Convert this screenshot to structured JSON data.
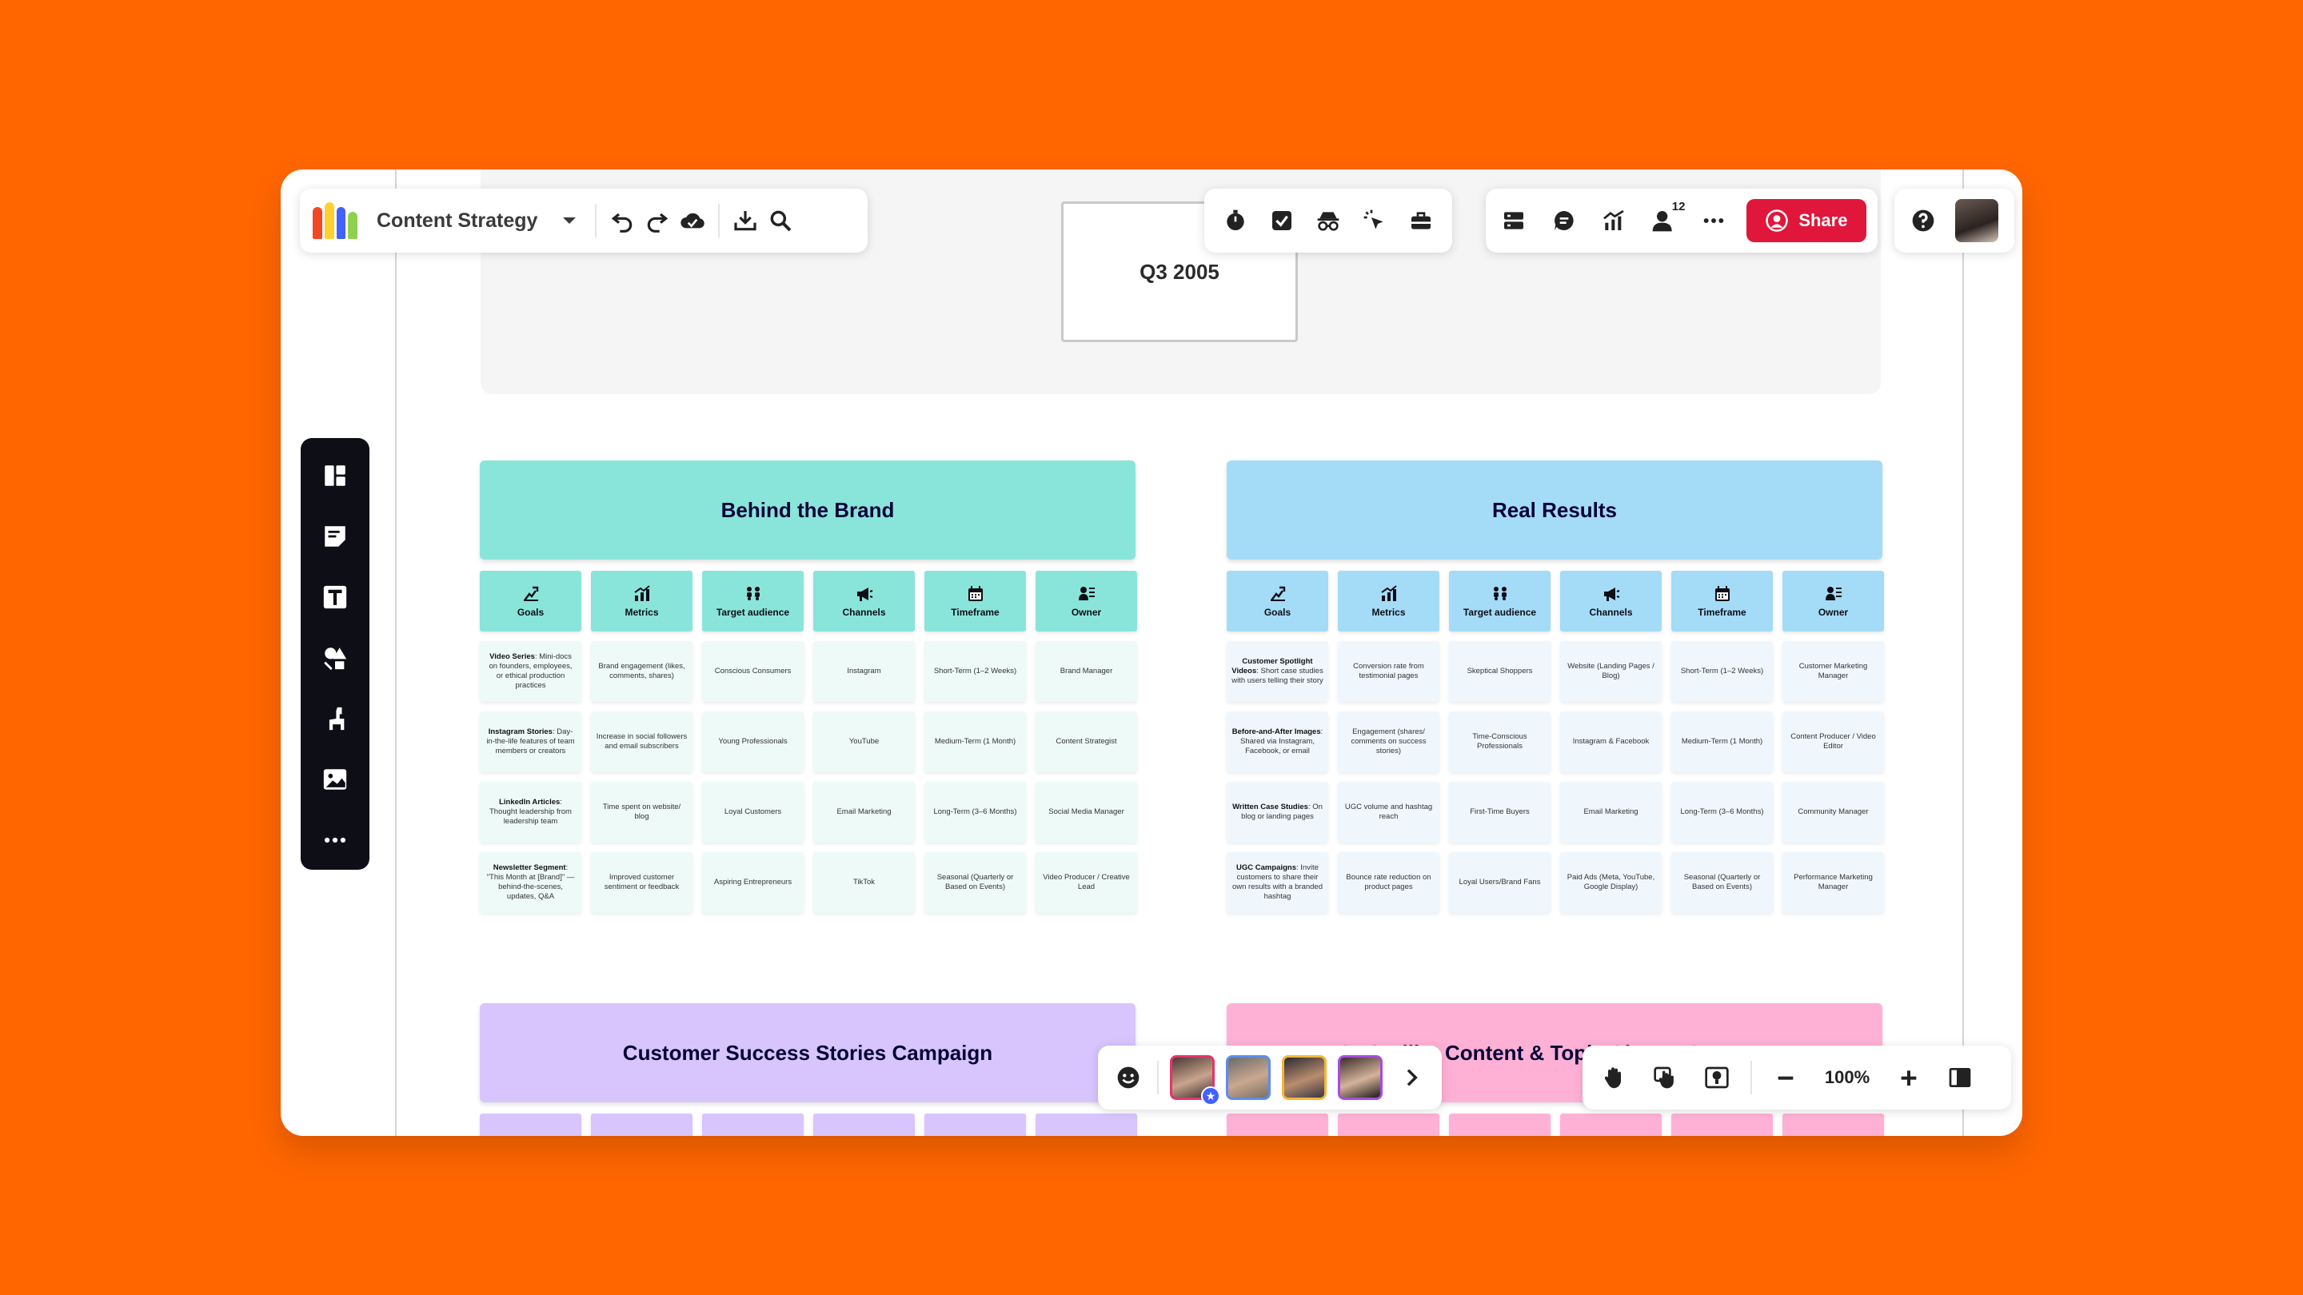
{
  "board": {
    "title": "Content Strategy",
    "date_card": "Q3 2005"
  },
  "toolbar_left": {
    "icons": [
      "dropdown-chevron-icon",
      "undo-icon",
      "redo-icon",
      "cloud-saved-icon",
      "export-icon",
      "search-icon"
    ]
  },
  "toolbar_tools": {
    "icons": [
      "timer-icon",
      "checklist-icon",
      "private-mode-icon",
      "attention-icon",
      "toolbox-icon"
    ]
  },
  "toolbar_collab": {
    "participants_count": "12",
    "share_label": "Share"
  },
  "sidebar": {
    "icons": [
      "templates-icon",
      "sticky-note-icon",
      "text-icon",
      "shapes-icon",
      "llama-icon",
      "image-icon",
      "more-icon"
    ]
  },
  "columns": [
    "Goals",
    "Metrics",
    "Target audience",
    "Channels",
    "Timeframe",
    "Owner"
  ],
  "sections": [
    {
      "title": "Behind the Brand",
      "color": "#89E5D9",
      "rows": [
        [
          {
            "bold": "Video Series",
            "text": ": Mini-docs on founders, employees, or ethical production practices"
          },
          {
            "bold": "",
            "text": "Brand engagement (likes, comments, shares)"
          },
          {
            "bold": "",
            "text": "Conscious Consumers"
          },
          {
            "bold": "",
            "text": "Instagram"
          },
          {
            "bold": "",
            "text": "Short-Term (1–2 Weeks)"
          },
          {
            "bold": "",
            "text": "Brand Manager"
          }
        ],
        [
          {
            "bold": "Instagram Stories",
            "text": ": Day-in-the-life features of team members or creators"
          },
          {
            "bold": "",
            "text": "Increase in social followers and email subscribers"
          },
          {
            "bold": "",
            "text": "Young Professionals"
          },
          {
            "bold": "",
            "text": "YouTube"
          },
          {
            "bold": "",
            "text": "Medium-Term (1 Month)"
          },
          {
            "bold": "",
            "text": "Content Strategist"
          }
        ],
        [
          {
            "bold": "LinkedIn Articles",
            "text": ": Thought leadership from leadership team"
          },
          {
            "bold": "",
            "text": "Time spent on website/ blog"
          },
          {
            "bold": "",
            "text": "Loyal Customers"
          },
          {
            "bold": "",
            "text": "Email Marketing"
          },
          {
            "bold": "",
            "text": "Long-Term (3–6 Months)"
          },
          {
            "bold": "",
            "text": "Social Media Manager"
          }
        ],
        [
          {
            "bold": "Newsletter Segment",
            "text": ": \"This Month at [Brand]\" — behind-the-scenes, updates, Q&A"
          },
          {
            "bold": "",
            "text": "Improved customer sentiment or feedback"
          },
          {
            "bold": "",
            "text": "Aspiring Entrepreneurs"
          },
          {
            "bold": "",
            "text": "TikTok"
          },
          {
            "bold": "",
            "text": "Seasonal (Quarterly or Based on Events)"
          },
          {
            "bold": "",
            "text": "Video Producer / Creative Lead"
          }
        ]
      ]
    },
    {
      "title": "Real Results",
      "color": "#A4DBF7",
      "rows": [
        [
          {
            "bold": "Customer Spotlight Videos",
            "text": ": Short case studies with users telling their story"
          },
          {
            "bold": "",
            "text": "Conversion rate from testimonial pages"
          },
          {
            "bold": "",
            "text": "Skeptical Shoppers"
          },
          {
            "bold": "",
            "text": "Website (Landing Pages / Blog)"
          },
          {
            "bold": "",
            "text": "Short-Term (1–2 Weeks)"
          },
          {
            "bold": "",
            "text": "Customer Marketing Manager"
          }
        ],
        [
          {
            "bold": "Before-and-After Images",
            "text": ": Shared via Instagram, Facebook, or email"
          },
          {
            "bold": "",
            "text": "Engagement (shares/ comments on success stories)"
          },
          {
            "bold": "",
            "text": "Time-Conscious Professionals"
          },
          {
            "bold": "",
            "text": "Instagram & Facebook"
          },
          {
            "bold": "",
            "text": "Medium-Term (1 Month)"
          },
          {
            "bold": "",
            "text": "Content Producer / Video Editor"
          }
        ],
        [
          {
            "bold": "Written Case Studies",
            "text": ": On blog or landing pages"
          },
          {
            "bold": "",
            "text": "UGC volume and hashtag reach"
          },
          {
            "bold": "",
            "text": "First-Time Buyers"
          },
          {
            "bold": "",
            "text": "Email Marketing"
          },
          {
            "bold": "",
            "text": "Long-Term (3–6 Months)"
          },
          {
            "bold": "",
            "text": "Community Manager"
          }
        ],
        [
          {
            "bold": "UGC Campaigns",
            "text": ": Invite customers to share their own results with a branded hashtag"
          },
          {
            "bold": "",
            "text": "Bounce rate reduction on product pages"
          },
          {
            "bold": "",
            "text": "Loyal Users/Brand Fans"
          },
          {
            "bold": "",
            "text": "Paid Ads (Meta, YouTube, Google Display)"
          },
          {
            "bold": "",
            "text": "Seasonal (Quarterly or Based on Events)"
          },
          {
            "bold": "",
            "text": "Performance Marketing Manager"
          }
        ]
      ]
    },
    {
      "title": "Customer Success Stories Campaign",
      "color": "#D8C5FD"
    },
    {
      "title": "SEO Pillar Content & Topic Cluster Strategy",
      "color": "#FFB1D5"
    }
  ],
  "people_bar": {
    "icons": [
      "reaction-icon",
      "chevron-right-icon"
    ]
  },
  "zoom_bar": {
    "zoom": "100%"
  }
}
